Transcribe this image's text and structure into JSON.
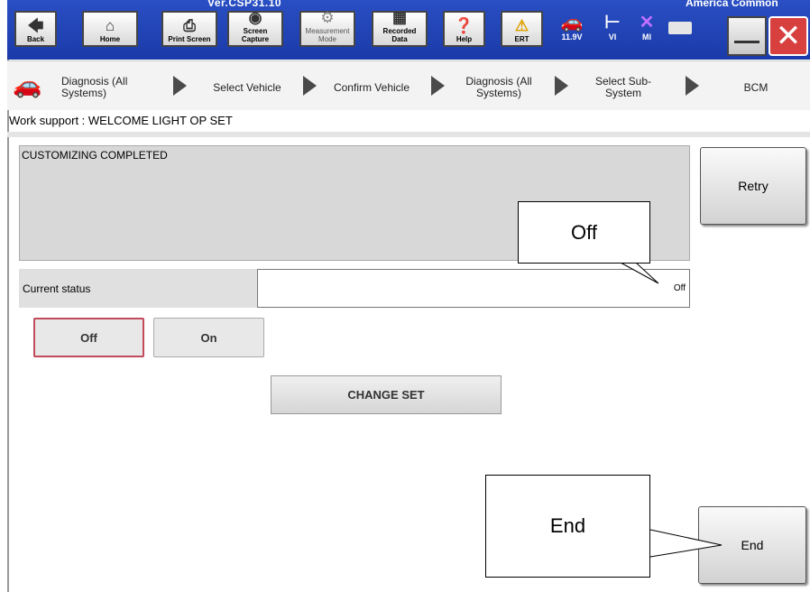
{
  "header": {
    "version": "Ver.CSP31.10",
    "region": "America Common"
  },
  "toolbar": {
    "back": "Back",
    "home": "Home",
    "print_screen": "Print Screen",
    "screen_capture": "Screen Capture",
    "measurement_mode": "Measurement Mode",
    "recorded_data": "Recorded Data",
    "help": "Help",
    "ert": "ERT",
    "voltage": "11.9V",
    "vi": "VI",
    "mi": "MI"
  },
  "breadcrumb": {
    "items": [
      "Diagnosis (All Systems)",
      "Select Vehicle",
      "Confirm Vehicle",
      "Diagnosis (All Systems)",
      "Select Sub-System",
      "BCM"
    ]
  },
  "work_support": "Work support : WELCOME LIGHT OP SET",
  "message": "CUSTOMIZING COMPLETED",
  "retry_label": "Retry",
  "status": {
    "label": "Current status",
    "value": "Off"
  },
  "options": {
    "off": "Off",
    "on": "On",
    "selected": "off"
  },
  "change_set_label": "CHANGE SET",
  "end_label": "End",
  "callouts": {
    "off": "Off",
    "end": "End"
  }
}
